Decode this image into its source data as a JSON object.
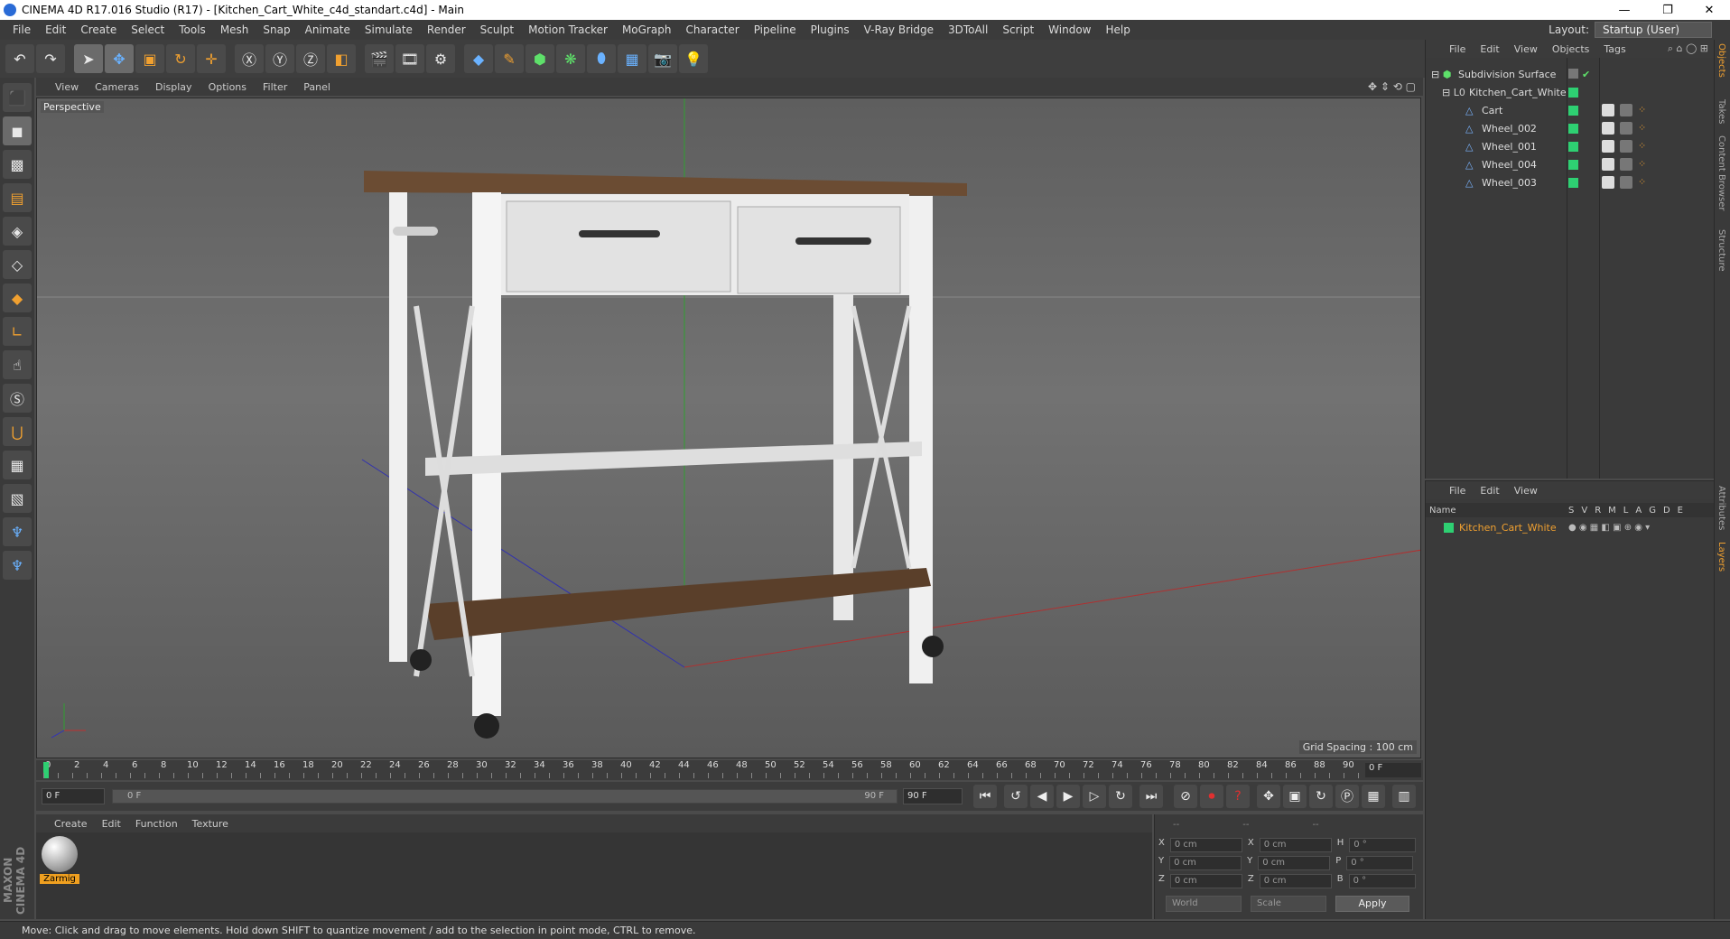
{
  "window": {
    "title": "CINEMA 4D R17.016 Studio (R17) - [Kitchen_Cart_White_c4d_standart.c4d] - Main",
    "minimize": "—",
    "restore": "❐",
    "close": "✕"
  },
  "menubar": [
    "File",
    "Edit",
    "Create",
    "Select",
    "Tools",
    "Mesh",
    "Snap",
    "Animate",
    "Simulate",
    "Render",
    "Sculpt",
    "Motion Tracker",
    "MoGraph",
    "Character",
    "Pipeline",
    "Plugins",
    "V-Ray Bridge",
    "3DToAll",
    "Script",
    "Window",
    "Help"
  ],
  "layout": {
    "label": "Layout:",
    "value": "Startup (User)"
  },
  "viewport": {
    "menu": [
      "View",
      "Cameras",
      "Display",
      "Options",
      "Filter",
      "Panel"
    ],
    "camera_label": "Perspective",
    "grid_spacing": "Grid Spacing : 100 cm"
  },
  "timeline": {
    "ticks": [
      "0",
      "2",
      "4",
      "6",
      "8",
      "10",
      "12",
      "14",
      "16",
      "18",
      "20",
      "22",
      "24",
      "26",
      "28",
      "30",
      "32",
      "34",
      "36",
      "38",
      "40",
      "42",
      "44",
      "46",
      "48",
      "50",
      "52",
      "54",
      "56",
      "58",
      "60",
      "62",
      "64",
      "66",
      "68",
      "70",
      "72",
      "74",
      "76",
      "78",
      "80",
      "82",
      "84",
      "86",
      "88",
      "90"
    ],
    "current_frame": "0 F",
    "start_field": "0 F",
    "range_start": "0 F",
    "range_end": "90 F",
    "end_field": "90 F"
  },
  "material_panel": {
    "menu": [
      "Create",
      "Edit",
      "Function",
      "Texture"
    ],
    "material_name": "Zarmig"
  },
  "coordinates": {
    "header": [
      "--",
      "--",
      "--"
    ],
    "rows": [
      {
        "a": "X",
        "av": "0 cm",
        "b": "X",
        "bv": "0 cm",
        "c": "H",
        "cv": "0 °"
      },
      {
        "a": "Y",
        "av": "0 cm",
        "b": "Y",
        "bv": "0 cm",
        "c": "P",
        "cv": "0 °"
      },
      {
        "a": "Z",
        "av": "0 cm",
        "b": "Z",
        "bv": "0 cm",
        "c": "B",
        "cv": "0 °"
      }
    ],
    "space": "World",
    "mode": "Scale",
    "apply": "Apply"
  },
  "objects_panel": {
    "menu": [
      "File",
      "Edit",
      "View",
      "Objects",
      "Tags"
    ],
    "items": [
      {
        "name": "Subdivision Surface",
        "indent": 0
      },
      {
        "name": "Kitchen_Cart_White",
        "indent": 1
      },
      {
        "name": "Cart",
        "indent": 2
      },
      {
        "name": "Wheel_002",
        "indent": 2
      },
      {
        "name": "Wheel_001",
        "indent": 2
      },
      {
        "name": "Wheel_004",
        "indent": 2
      },
      {
        "name": "Wheel_003",
        "indent": 2
      }
    ]
  },
  "layers_panel": {
    "menu": [
      "File",
      "Edit",
      "View"
    ],
    "header": {
      "name": "Name",
      "cols": [
        "S",
        "V",
        "R",
        "M",
        "L",
        "A",
        "G",
        "D",
        "E"
      ]
    },
    "layer": "Kitchen_Cart_White"
  },
  "right_tabs": [
    "Objects",
    "Takes",
    "Content Browser",
    "Structure",
    "Attributes",
    "Layers"
  ],
  "status": "Move: Click and drag to move elements. Hold down SHIFT to quantize movement / add to the selection in point mode, CTRL to remove.",
  "brand": "MAXON CINEMA 4D",
  "colors": {
    "accent": "#f0a030",
    "layer_green": "#2ed072",
    "x_axis": "#c83030",
    "y_axis": "#30b030",
    "z_axis": "#3030c8"
  }
}
